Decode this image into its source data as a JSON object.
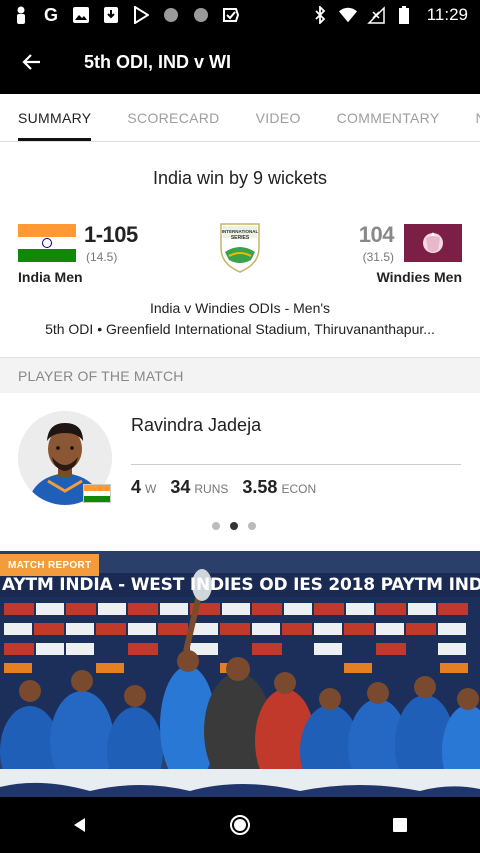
{
  "status_bar": {
    "time": "11:29",
    "left_icons": [
      "person-icon",
      "google-icon",
      "image-icon",
      "download-icon",
      "play-store-icon",
      "circle-icon",
      "circle-icon",
      "checkmark-icon"
    ],
    "right_icons": [
      "bluetooth-icon",
      "wifi-icon",
      "no-signal-icon",
      "battery-icon"
    ]
  },
  "app_bar": {
    "title": "5th ODI, IND v WI"
  },
  "tabs": [
    {
      "label": "SUMMARY",
      "active": true
    },
    {
      "label": "SCORECARD"
    },
    {
      "label": "VIDEO"
    },
    {
      "label": "COMMENTARY"
    },
    {
      "label": "N"
    }
  ],
  "result": {
    "headline": "India win by 9 wickets"
  },
  "team_home": {
    "name": "India Men",
    "score": "1-105",
    "overs": "(14.5)"
  },
  "team_away": {
    "name": "Windies Men",
    "score": "104",
    "overs": "(31.5)"
  },
  "series_logo_text": [
    "INTERNATIONAL",
    "SERIES"
  ],
  "match_info": {
    "series": "India v Windies ODIs - Men's",
    "venue": "5th ODI • Greenfield International Stadium, Thiruvananthapur..."
  },
  "player_of_match": {
    "section_title": "PLAYER OF THE MATCH",
    "name": "Ravindra Jadeja",
    "stats": [
      {
        "value": "4",
        "unit": "W"
      },
      {
        "value": "34",
        "unit": "RUNS"
      },
      {
        "value": "3.58",
        "unit": "ECON"
      }
    ],
    "carousel_active_index": 1
  },
  "match_report": {
    "tag": "MATCH REPORT",
    "banner_text": "AYTM INDIA - WEST INDIES OD   IES 2018 PAYTM INDIA - WEST INDIES ODI"
  },
  "nav_bar": {
    "buttons": [
      "back-icon",
      "home-icon",
      "recents-icon"
    ]
  }
}
